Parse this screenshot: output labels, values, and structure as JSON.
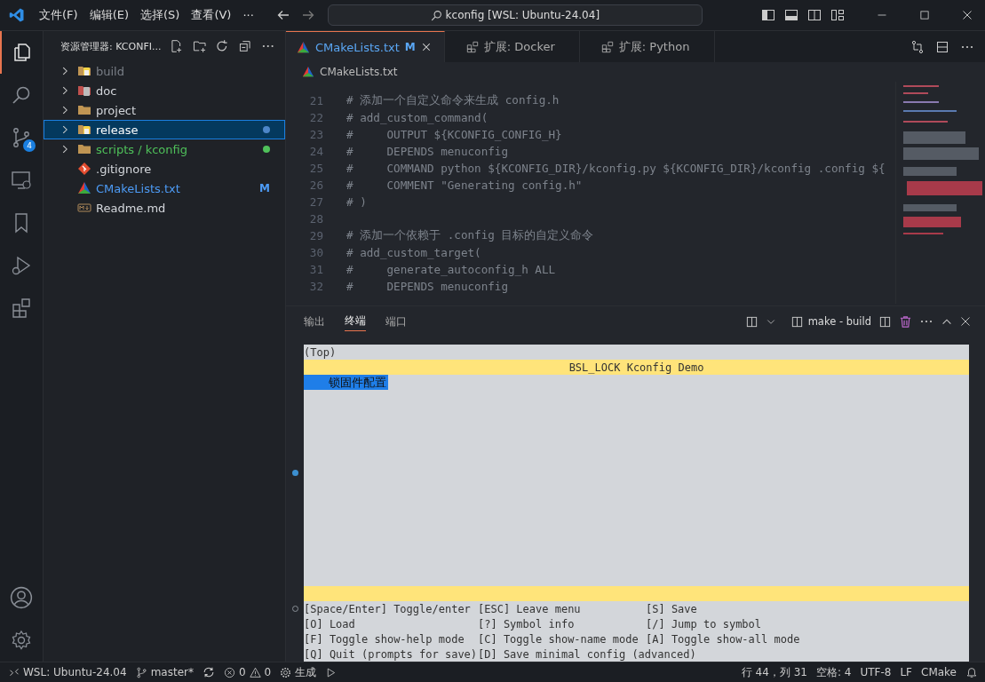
{
  "title_bar": {
    "menus": [
      "文件(F)",
      "编辑(E)",
      "选择(S)",
      "查看(V)",
      "···"
    ],
    "search": "kconfig [WSL: Ubuntu-24.04]"
  },
  "activity_bar": [
    {
      "kind": "files",
      "selected": true
    },
    {
      "kind": "search",
      "selected": false
    },
    {
      "kind": "source-control",
      "selected": false,
      "badge": "4"
    },
    {
      "kind": "remote",
      "selected": false
    },
    {
      "kind": "bookmark",
      "selected": false
    },
    {
      "kind": "debug",
      "selected": false
    },
    {
      "kind": "extensions",
      "selected": false
    }
  ],
  "explorer": {
    "title": "资源管理器: KCONFI...",
    "items": [
      {
        "name": "build",
        "kind": "folder-special",
        "color": "#7a7f87",
        "dot": false,
        "selected": false
      },
      {
        "name": "doc",
        "kind": "folder-doc",
        "dot": false,
        "selected": false
      },
      {
        "name": "project",
        "kind": "folder",
        "dot": false,
        "selected": false
      },
      {
        "name": "release",
        "kind": "folder-special",
        "color": "#4d86c8",
        "dot": true,
        "selected": true
      },
      {
        "name": "scripts / kconfig",
        "kind": "folder",
        "color": "#4fc15a",
        "dot": true,
        "selected": false
      },
      {
        "name": ".gitignore",
        "kind": "git",
        "dot": false,
        "selected": false
      },
      {
        "name": "CMakeLists.txt",
        "kind": "cmake",
        "color": "#4d9cf7",
        "badge": "M",
        "dot": false,
        "selected": false
      },
      {
        "name": "Readme.md",
        "kind": "markdown",
        "dot": false,
        "selected": false
      }
    ]
  },
  "tabs": [
    {
      "label": "CMakeLists.txt",
      "kind": "cmake",
      "badge": "M",
      "selected": true
    },
    {
      "label": "扩展: Docker",
      "kind": "extension",
      "selected": false
    },
    {
      "label": "扩展: Python",
      "kind": "extension",
      "selected": false
    }
  ],
  "breadcrumb": "CMakeLists.txt",
  "code": [
    {
      "num": "21",
      "text": "# 添加一个自定义命令来生成 config.h"
    },
    {
      "num": "22",
      "text": "# add_custom_command("
    },
    {
      "num": "23",
      "text": "#     OUTPUT ${KCONFIG_CONFIG_H}"
    },
    {
      "num": "24",
      "text": "#     DEPENDS menuconfig"
    },
    {
      "num": "25",
      "text": "#     COMMAND python ${KCONFIG_DIR}/kconfig.py ${KCONFIG_DIR}/kconfig .config ${"
    },
    {
      "num": "26",
      "text": "#     COMMENT \"Generating config.h\""
    },
    {
      "num": "27",
      "text": "# )"
    },
    {
      "num": "28"
    },
    {
      "num": "29",
      "text": "# 添加一个依赖于 .config 目标的自定义命令"
    },
    {
      "num": "30",
      "text": "# add_custom_target("
    },
    {
      "num": "31",
      "text": "#     generate_autoconfig_h ALL"
    },
    {
      "num": "32",
      "text": "#     DEPENDS menuconfig"
    }
  ],
  "panel": {
    "tabs": [
      {
        "label": "输出",
        "selected": false
      },
      {
        "label": "终端",
        "selected": true
      },
      {
        "label": "端口",
        "selected": false
      }
    ],
    "terminal_name": "make - build"
  },
  "terminal": [
    {
      "kind": "plain",
      "cells": [
        "(Top)"
      ]
    },
    {
      "kind": "title",
      "cells": [
        "BSL_LOCK Kconfig Demo"
      ]
    },
    {
      "kind": "selected",
      "cells": [
        "锁固件配置"
      ]
    },
    {
      "kind": "blank"
    },
    {
      "kind": "blank"
    },
    {
      "kind": "blank"
    },
    {
      "kind": "blank"
    },
    {
      "kind": "blank"
    },
    {
      "kind": "blank",
      "marker": {
        "kind": "filled"
      }
    },
    {
      "kind": "blank"
    },
    {
      "kind": "blank"
    },
    {
      "kind": "blank"
    },
    {
      "kind": "blank"
    },
    {
      "kind": "blank"
    },
    {
      "kind": "blank"
    },
    {
      "kind": "blank"
    },
    {
      "kind": "bar"
    },
    {
      "kind": "help",
      "marker": {
        "kind": "hollow"
      },
      "cells": [
        "[Space/Enter] Toggle/enter",
        "[ESC] Leave menu",
        "[S] Save"
      ]
    },
    {
      "kind": "help",
      "cells": [
        "[O] Load",
        "[?] Symbol info",
        "[/] Jump to symbol"
      ]
    },
    {
      "kind": "help",
      "cells": [
        "[F] Toggle show-help mode",
        "[C] Toggle show-name mode",
        "[A] Toggle show-all mode"
      ]
    },
    {
      "kind": "help",
      "cells": [
        "[Q] Quit (prompts for save)",
        "[D] Save minimal config (advanced)"
      ]
    }
  ],
  "status_bar": {
    "remote": "WSL: Ubuntu-24.04",
    "branch": "master*",
    "errors": "0",
    "warnings": "0",
    "build": "生成",
    "right": [
      "行 44，列 31",
      "空格: 4",
      "UTF-8",
      "LF",
      "CMake"
    ]
  }
}
